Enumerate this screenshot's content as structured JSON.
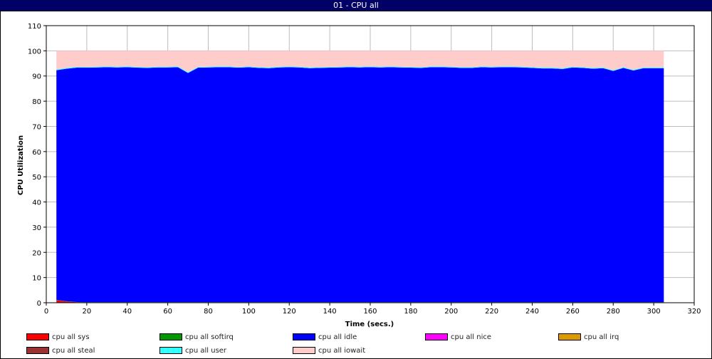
{
  "window": {
    "title": "01 - CPU all"
  },
  "chart_data": {
    "type": "area",
    "stacked": true,
    "xlabel": "Time (secs.)",
    "ylabel": "CPU Utilization",
    "xlim": [
      0,
      320
    ],
    "ylim": [
      0,
      110
    ],
    "x_ticks": [
      0,
      20,
      40,
      60,
      80,
      100,
      120,
      140,
      160,
      180,
      200,
      220,
      240,
      260,
      280,
      300,
      320
    ],
    "y_ticks": [
      0,
      10,
      20,
      30,
      40,
      50,
      60,
      70,
      80,
      90,
      100,
      110
    ],
    "grid": true,
    "legend_position": "bottom",
    "x": [
      5,
      10,
      15,
      20,
      25,
      30,
      35,
      40,
      45,
      50,
      55,
      60,
      65,
      70,
      75,
      80,
      85,
      90,
      95,
      100,
      105,
      110,
      115,
      120,
      125,
      130,
      135,
      140,
      145,
      150,
      155,
      160,
      165,
      170,
      175,
      180,
      185,
      190,
      195,
      200,
      205,
      210,
      215,
      220,
      225,
      230,
      235,
      240,
      245,
      250,
      255,
      260,
      265,
      270,
      275,
      280,
      285,
      290,
      295,
      300,
      305
    ],
    "series": [
      {
        "name": "cpu all sys",
        "color": "#ff0000",
        "values": [
          1.0,
          0.5,
          0.2,
          0.1,
          0.1,
          0.1,
          0.1,
          0.1,
          0.1,
          0.1,
          0.1,
          0.1,
          0.1,
          0.1,
          0.1,
          0.1,
          0.1,
          0.1,
          0.1,
          0.1,
          0.1,
          0.1,
          0.1,
          0.1,
          0.1,
          0.1,
          0.1,
          0.1,
          0.1,
          0.1,
          0.1,
          0.1,
          0.1,
          0.1,
          0.1,
          0.1,
          0.1,
          0.1,
          0.1,
          0.1,
          0.1,
          0.1,
          0.1,
          0.1,
          0.1,
          0.1,
          0.1,
          0.1,
          0.1,
          0.1,
          0.1,
          0.1,
          0.1,
          0.1,
          0.1,
          0.1,
          0.1,
          0.1,
          0.1,
          0.1,
          0.1
        ]
      },
      {
        "name": "cpu all softirq",
        "color": "#009900",
        "values": [
          0.1,
          0.1,
          0.1,
          0.1,
          0.1,
          0.1,
          0.1,
          0.1,
          0.1,
          0.1,
          0.1,
          0.1,
          0.1,
          0.1,
          0.1,
          0.1,
          0.1,
          0.1,
          0.1,
          0.1,
          0.1,
          0.1,
          0.1,
          0.1,
          0.1,
          0.1,
          0.1,
          0.1,
          0.1,
          0.1,
          0.1,
          0.1,
          0.1,
          0.1,
          0.1,
          0.1,
          0.1,
          0.1,
          0.1,
          0.1,
          0.1,
          0.1,
          0.1,
          0.1,
          0.1,
          0.1,
          0.1,
          0.1,
          0.1,
          0.1,
          0.1,
          0.1,
          0.1,
          0.1,
          0.1,
          0.1,
          0.1,
          0.1,
          0.1,
          0.1,
          0.1
        ]
      },
      {
        "name": "cpu all idle",
        "color": "#0000ff",
        "values": [
          91.2,
          92.3,
          93.0,
          93.1,
          93.2,
          93.3,
          93.2,
          93.3,
          93.1,
          93.0,
          93.2,
          93.2,
          93.3,
          91.0,
          93.1,
          93.2,
          93.3,
          93.3,
          93.1,
          93.3,
          93.0,
          92.9,
          93.2,
          93.3,
          93.2,
          92.9,
          93.0,
          93.1,
          93.2,
          93.3,
          93.2,
          93.3,
          93.2,
          93.3,
          93.2,
          93.1,
          93.0,
          93.3,
          93.3,
          93.2,
          93.0,
          93.0,
          93.3,
          93.2,
          93.3,
          93.3,
          93.2,
          93.0,
          92.8,
          92.8,
          92.6,
          93.2,
          93.0,
          92.7,
          92.9,
          91.8,
          93.0,
          92.0,
          92.9,
          92.9,
          92.9
        ]
      },
      {
        "name": "cpu all nice",
        "color": "#ff00ff",
        "values": [
          0,
          0,
          0,
          0,
          0,
          0,
          0,
          0,
          0,
          0,
          0,
          0,
          0,
          0,
          0,
          0,
          0,
          0,
          0,
          0,
          0,
          0,
          0,
          0,
          0,
          0,
          0,
          0,
          0,
          0,
          0,
          0,
          0,
          0,
          0,
          0,
          0,
          0,
          0,
          0,
          0,
          0,
          0,
          0,
          0,
          0,
          0,
          0,
          0,
          0,
          0,
          0,
          0,
          0,
          0,
          0,
          0,
          0,
          0,
          0,
          0
        ]
      },
      {
        "name": "cpu all irq",
        "color": "#dd9900",
        "values": [
          0,
          0,
          0,
          0,
          0,
          0,
          0,
          0,
          0,
          0,
          0,
          0,
          0,
          0,
          0,
          0,
          0,
          0,
          0,
          0,
          0,
          0,
          0,
          0,
          0,
          0,
          0,
          0,
          0,
          0,
          0,
          0,
          0,
          0,
          0,
          0,
          0,
          0,
          0,
          0,
          0,
          0,
          0,
          0,
          0,
          0,
          0,
          0,
          0,
          0,
          0,
          0,
          0,
          0,
          0,
          0,
          0,
          0,
          0,
          0,
          0
        ]
      },
      {
        "name": "cpu all steal",
        "color": "#993333",
        "values": [
          0,
          0,
          0,
          0,
          0,
          0,
          0,
          0,
          0,
          0,
          0,
          0,
          0,
          0,
          0,
          0,
          0,
          0,
          0,
          0,
          0,
          0,
          0,
          0,
          0,
          0,
          0,
          0,
          0,
          0,
          0,
          0,
          0,
          0,
          0,
          0,
          0,
          0,
          0,
          0,
          0,
          0,
          0,
          0,
          0,
          0,
          0,
          0,
          0,
          0,
          0,
          0,
          0,
          0,
          0,
          0,
          0,
          0,
          0,
          0,
          0
        ]
      },
      {
        "name": "cpu all user",
        "color": "#33ffff",
        "values": [
          0.3,
          0.3,
          0.3,
          0.3,
          0.3,
          0.3,
          0.3,
          0.3,
          0.3,
          0.3,
          0.3,
          0.3,
          0.3,
          0.3,
          0.3,
          0.3,
          0.3,
          0.3,
          0.3,
          0.3,
          0.3,
          0.3,
          0.3,
          0.3,
          0.3,
          0.3,
          0.3,
          0.3,
          0.3,
          0.3,
          0.3,
          0.3,
          0.3,
          0.3,
          0.3,
          0.3,
          0.3,
          0.3,
          0.3,
          0.3,
          0.3,
          0.3,
          0.3,
          0.3,
          0.3,
          0.3,
          0.3,
          0.3,
          0.3,
          0.3,
          0.3,
          0.3,
          0.3,
          0.3,
          0.3,
          0.3,
          0.3,
          0.3,
          0.3,
          0.3,
          0.3
        ]
      },
      {
        "name": "cpu all iowait",
        "color": "#ffcccc",
        "values": [
          7.4,
          6.8,
          6.4,
          6.4,
          6.3,
          6.2,
          6.3,
          6.2,
          6.4,
          6.5,
          6.3,
          6.3,
          6.2,
          8.5,
          6.4,
          6.3,
          6.2,
          6.2,
          6.4,
          6.2,
          6.5,
          6.6,
          6.3,
          6.2,
          6.3,
          6.6,
          6.5,
          6.4,
          6.3,
          6.2,
          6.3,
          6.2,
          6.3,
          6.2,
          6.3,
          6.4,
          6.5,
          6.2,
          6.2,
          6.3,
          6.5,
          6.5,
          6.2,
          6.3,
          6.2,
          6.2,
          6.3,
          6.5,
          6.7,
          6.7,
          6.9,
          6.3,
          6.5,
          6.8,
          6.6,
          7.7,
          6.5,
          7.5,
          6.6,
          6.6,
          6.6
        ]
      }
    ]
  }
}
